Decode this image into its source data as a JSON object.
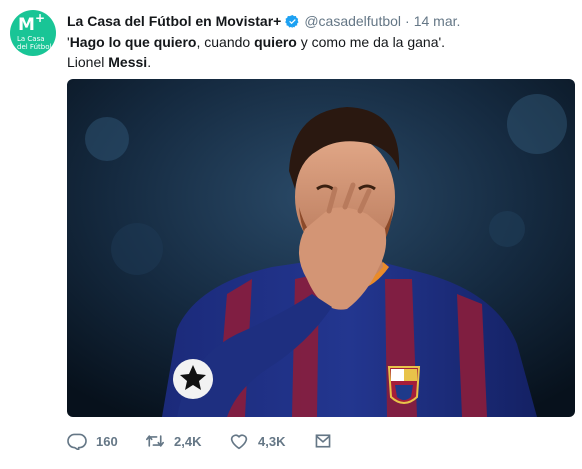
{
  "tweet": {
    "avatar": {
      "brand_mark": "M",
      "brand_plus": "+",
      "brand_line1": "La Casa",
      "brand_line2": "del Fútbol",
      "color": "#19c596"
    },
    "author": {
      "display_name": "La Casa del Fútbol en Movistar+",
      "handle": "@casadelfutbol",
      "separator": "·",
      "date": "14 mar.",
      "verified_icon": "verified-badge-icon"
    },
    "text": {
      "quote_open": "'",
      "bold_1": "Hago lo que quiero",
      "plain_1": ", cuando ",
      "bold_2": "quiero",
      "plain_2": " y como me da la gana'.",
      "plain_3": "Lionel ",
      "bold_3": "Messi",
      "plain_4": "."
    },
    "media": {
      "type": "photo",
      "badge_stars_icon": "champions-league-starball-icon",
      "crest_icon": "fc-barcelona-crest-icon"
    },
    "actions": {
      "reply": {
        "icon": "reply-icon",
        "count": "160"
      },
      "retweet": {
        "icon": "retweet-icon",
        "count": "2,4K"
      },
      "like": {
        "icon": "heart-icon",
        "count": "4,3K"
      },
      "dm": {
        "icon": "envelope-icon"
      }
    },
    "colors": {
      "text": "#14171a",
      "secondary": "#657786",
      "verified": "#1da1f2"
    }
  }
}
